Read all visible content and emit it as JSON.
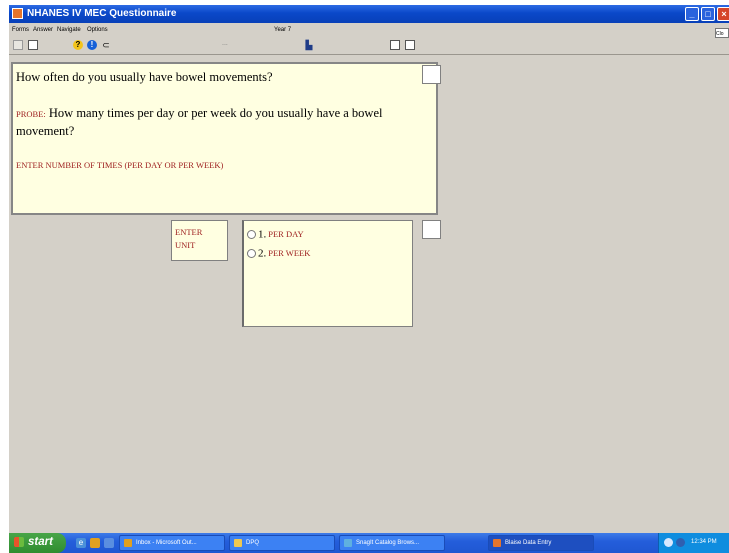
{
  "window": {
    "title": "NHANES IV MEC Questionnaire",
    "menu": [
      "Forms",
      "Answer",
      "Navigate",
      "Options"
    ],
    "year_label": "Year 7",
    "close_hint": "Clo"
  },
  "window_controls": {
    "minimize": "_",
    "maximize": "□",
    "close": "×"
  },
  "toolbar": {
    "separator": "..."
  },
  "question": {
    "main": "How often do you usually have bowel movements?",
    "probe_label": "PROBE:",
    "probe_text": "How many times per day or per week do you usually have a bowel movement?",
    "instruction": "ENTER NUMBER OF TIMES (PER DAY OR PER WEEK)"
  },
  "unit_label": [
    "ENTER",
    "UNIT"
  ],
  "options": [
    {
      "number": "1.",
      "label": "PER DAY"
    },
    {
      "number": "2.",
      "label": "PER WEEK"
    }
  ],
  "taskbar": {
    "start": "start",
    "tasks": [
      {
        "label": "Inbox - Microsoft Out...",
        "active": false
      },
      {
        "label": "DPQ",
        "active": false
      },
      {
        "label": "SnagIt Catalog Brows...",
        "active": false
      },
      {
        "label": "Blaise Data Entry",
        "active": true
      }
    ],
    "clock": "12:34 PM"
  },
  "colors": {
    "title_bar": "#0a48c9",
    "question_bg": "#ffffe1",
    "instruction_red": "#9c1b1b",
    "taskbar_blue": "#245edb",
    "start_green": "#3c9a3c"
  }
}
